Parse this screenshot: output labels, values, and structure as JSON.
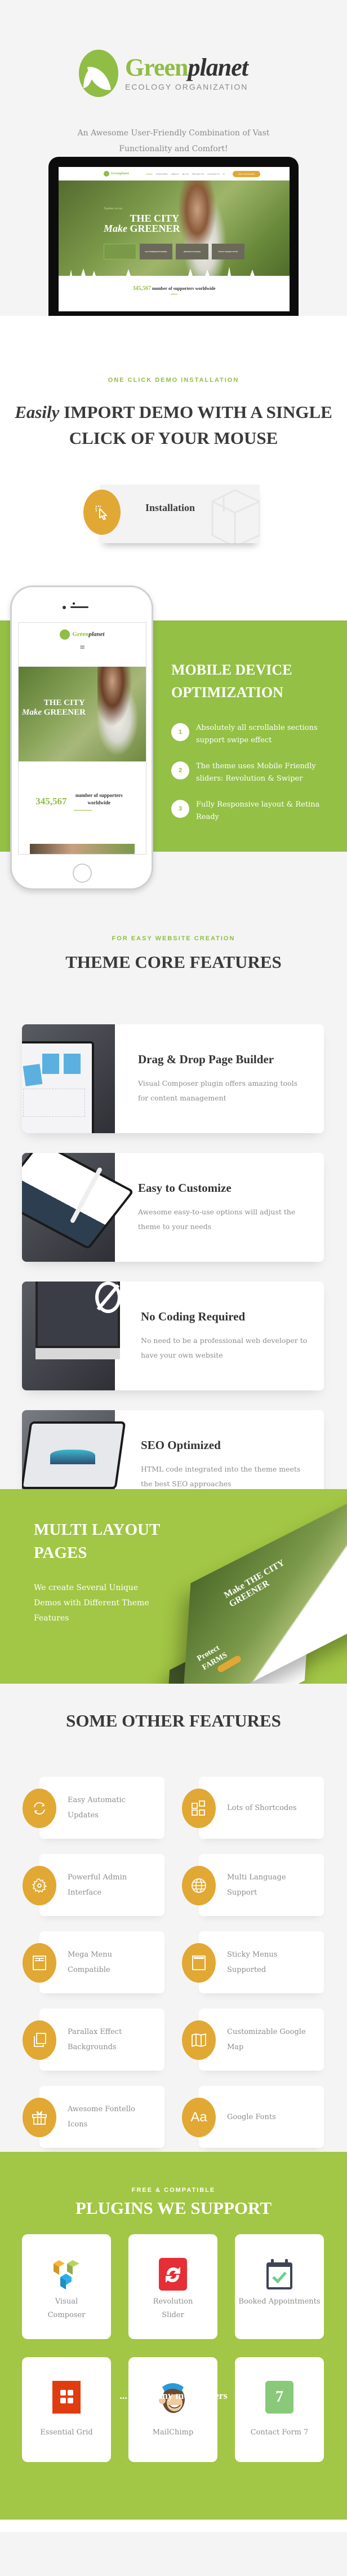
{
  "header": {
    "brand_green": "Green",
    "brand_dark": "planet",
    "brand_sub": "ECOLOGY ORGANIZATION",
    "tagline": "An Awesome User-Friendly Combination of Vast Functionality and Comfort!"
  },
  "laptop_preview": {
    "logo_text": "Greenplanet",
    "nav": [
      "HOME",
      "FEATURES",
      "ABOUT",
      "BLOG",
      "PROJECTS",
      "CONTACTS"
    ],
    "cta": "GET INVOLVED",
    "kicker": "Together we can",
    "title_italic": "Make",
    "title_rest": "THE CITY GREENER",
    "thumbs": [
      "",
      "Save Endangered Animals",
      "Alternative Energies",
      "Protect Organic Farms"
    ],
    "counter_value": "345,567",
    "counter_label": "number of supporters worldwide"
  },
  "install": {
    "kicker": "ONE CLICK DEMO INSTALLATION",
    "title_italic": "Easily",
    "title_rest": "IMPORT DEMO WITH A SINGLE CLICK OF YOUR MOUSE",
    "button_label": "Installation"
  },
  "mobile": {
    "phone_logo_green": "Green",
    "phone_logo_dark": "planet",
    "phone_menu_icon": "hamburger-icon",
    "phone_title_italic": "Make",
    "phone_title_rest": "THE CITY GREENER",
    "phone_counter_value": "345,567",
    "phone_counter_label": "number of supporters worldwide",
    "title": "MOBILE DEVICE OPTIMIZATION",
    "items": [
      {
        "num": "1",
        "text": "Absolutely all scrollable sections support swipe effect"
      },
      {
        "num": "2",
        "text": "The theme uses Mobile Friendly sliders: Revolution & Swiper"
      },
      {
        "num": "3",
        "text": "Fully Responsive layout & Retina Ready"
      }
    ]
  },
  "core": {
    "kicker": "FOR EASY WEBSITE CREATION",
    "title": "THEME CORE FEATURES",
    "features": [
      {
        "title": "Drag & Drop Page Builder",
        "desc": "Visual Composer plugin offers amazing tools for content management",
        "image": "laptop-builder-image"
      },
      {
        "title": "Easy to Customize",
        "desc": "Awesome easy-to-use options will adjust the theme to your needs",
        "image": "tablet-pen-image"
      },
      {
        "title": "No Coding Required",
        "desc": "No need to be a professional web developer to have your own website",
        "image": "imac-code-image"
      },
      {
        "title": "SEO Optimized",
        "desc": "HTML code integrated into the theme meets the best SEO approaches",
        "image": "tablet-seo-image"
      }
    ]
  },
  "multi": {
    "title": "MULTI LAYOUT PAGES",
    "desc": "We create Several Unique Demos with Different Theme Features",
    "mock_title": "Make THE CITY GREENER",
    "mock_title2": "Protect FARMS"
  },
  "other": {
    "title": "SOME OTHER FEATURES",
    "items": [
      {
        "label": "Easy Automatic Updates",
        "icon": "refresh-icon"
      },
      {
        "label": "Lots of Shortcodes",
        "icon": "shortcodes-icon"
      },
      {
        "label": "Powerful Admin Interface",
        "icon": "gear-icon"
      },
      {
        "label": "Multi Language Support",
        "icon": "globe-icon"
      },
      {
        "label": "Mega Menu Compatible",
        "icon": "mega-menu-icon"
      },
      {
        "label": "Sticky Menus Supported",
        "icon": "sticky-menu-icon"
      },
      {
        "label": "Parallax Effect Backgrounds",
        "icon": "layers-icon"
      },
      {
        "label": "Customizable Google Map",
        "icon": "map-icon"
      },
      {
        "label": "Awesome Fontello Icons",
        "icon": "gift-icon"
      },
      {
        "label": "Google Fonts",
        "icon": "font-icon"
      }
    ]
  },
  "plugins": {
    "kicker": "FREE & COMPATIBLE",
    "title": "PLUGINS WE SUPPORT",
    "items": [
      {
        "label": "Visual Composer",
        "icon": "visual-composer-icon"
      },
      {
        "label": "Revolution Slider",
        "icon": "revolution-slider-icon"
      },
      {
        "label": "Booked Appointments",
        "icon": "calendar-check-icon"
      },
      {
        "label": "Essential Grid",
        "icon": "essential-grid-icon"
      },
      {
        "label": "MailChimp",
        "icon": "mailchimp-icon"
      },
      {
        "label": "Contact Form 7",
        "icon": "contact-form-7-icon"
      }
    ],
    "cf7_badge": "7",
    "more": "... and many more others"
  },
  "colors": {
    "green": "#8fbd45",
    "green_band": "#a2c645",
    "gold": "#e1a833",
    "dark_text": "#3a3a3a",
    "muted_text": "#8d8d8d"
  }
}
